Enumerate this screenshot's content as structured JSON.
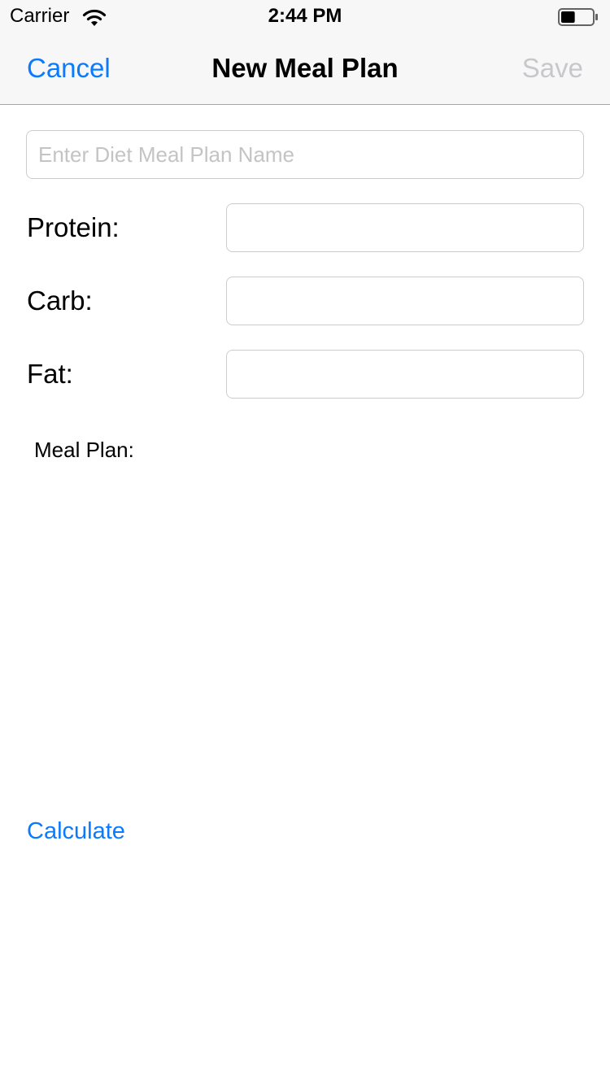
{
  "status_bar": {
    "carrier": "Carrier",
    "time": "2:44 PM",
    "wifi_icon": "wifi-icon",
    "battery_icon": "battery-icon",
    "battery_level": 0.45
  },
  "nav": {
    "cancel_label": "Cancel",
    "title": "New Meal Plan",
    "save_label": "Save",
    "accent_color": "#0a7afe",
    "disabled_color": "#c7c7cc"
  },
  "form": {
    "name_placeholder": "Enter Diet Meal Plan Name",
    "name_value": "",
    "fields": [
      {
        "label": "Protein:",
        "value": ""
      },
      {
        "label": "Carb:",
        "value": ""
      },
      {
        "label": "Fat:",
        "value": ""
      }
    ],
    "meal_plan_label": "Meal Plan:",
    "calculate_label": "Calculate"
  }
}
